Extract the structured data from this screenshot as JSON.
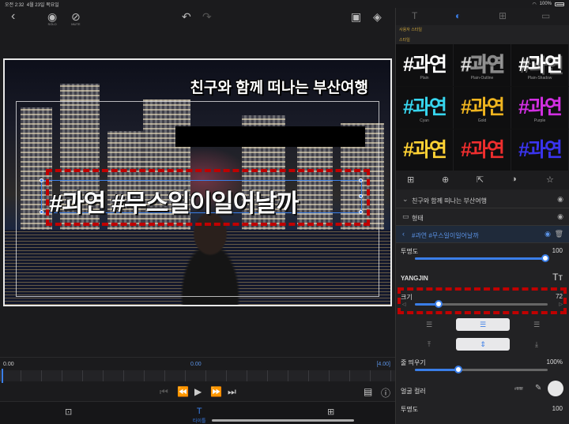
{
  "status": {
    "time": "오전 2:32",
    "date": "4월 23일 목요일",
    "battery": "100%"
  },
  "toolbar": {
    "solo_label": "SOLO",
    "mute_label": "MUTE"
  },
  "preview": {
    "caption_top": "친구와 함께 떠나는 부산여행",
    "hashtag_text": "#과연 #무스일이일어날까"
  },
  "timeline": {
    "start": "0.00",
    "current": "0.00",
    "end": "[4.00]"
  },
  "bottombar": {
    "title_tab": "타이틀"
  },
  "panel": {
    "user_styles_label": "사용자 스타일",
    "styles_label": "스타일",
    "style_sample": "#과연",
    "styles": [
      {
        "name": "Plain",
        "color": "#ffffff"
      },
      {
        "name": "Plain-Outline",
        "color": "#ffffff"
      },
      {
        "name": "Plain-Shadow",
        "color": "#ffffff"
      },
      {
        "name": "Cyan",
        "color": "#37d6ef"
      },
      {
        "name": "Gold",
        "color": "#f0b51f"
      },
      {
        "name": "Purple",
        "color": "#d22fe2"
      },
      {
        "name": "",
        "color": "#ffd234"
      },
      {
        "name": "",
        "color": "#ef2e2e"
      },
      {
        "name": "",
        "color": "#3a34f0"
      }
    ],
    "layers": [
      {
        "label": "친구와 함께 떠나는 부산여행"
      },
      {
        "label": "형태"
      },
      {
        "label": "#과연 #무스일이일어날까"
      }
    ],
    "opacity_label": "투명도",
    "opacity_value": "100",
    "opacity_fraction": 0.98,
    "font_name": "YANGJIN",
    "size_label": "크기",
    "size_value": "72",
    "size_fraction": 0.18,
    "line_spacing_label": "줄 띄우기",
    "line_spacing_value": "100%",
    "line_spacing_fraction": 0.33,
    "face_color_label": "얼굴 컬러",
    "face_color_value": "#ffffff",
    "opacity2_label": "투명도",
    "opacity2_value": "100"
  }
}
